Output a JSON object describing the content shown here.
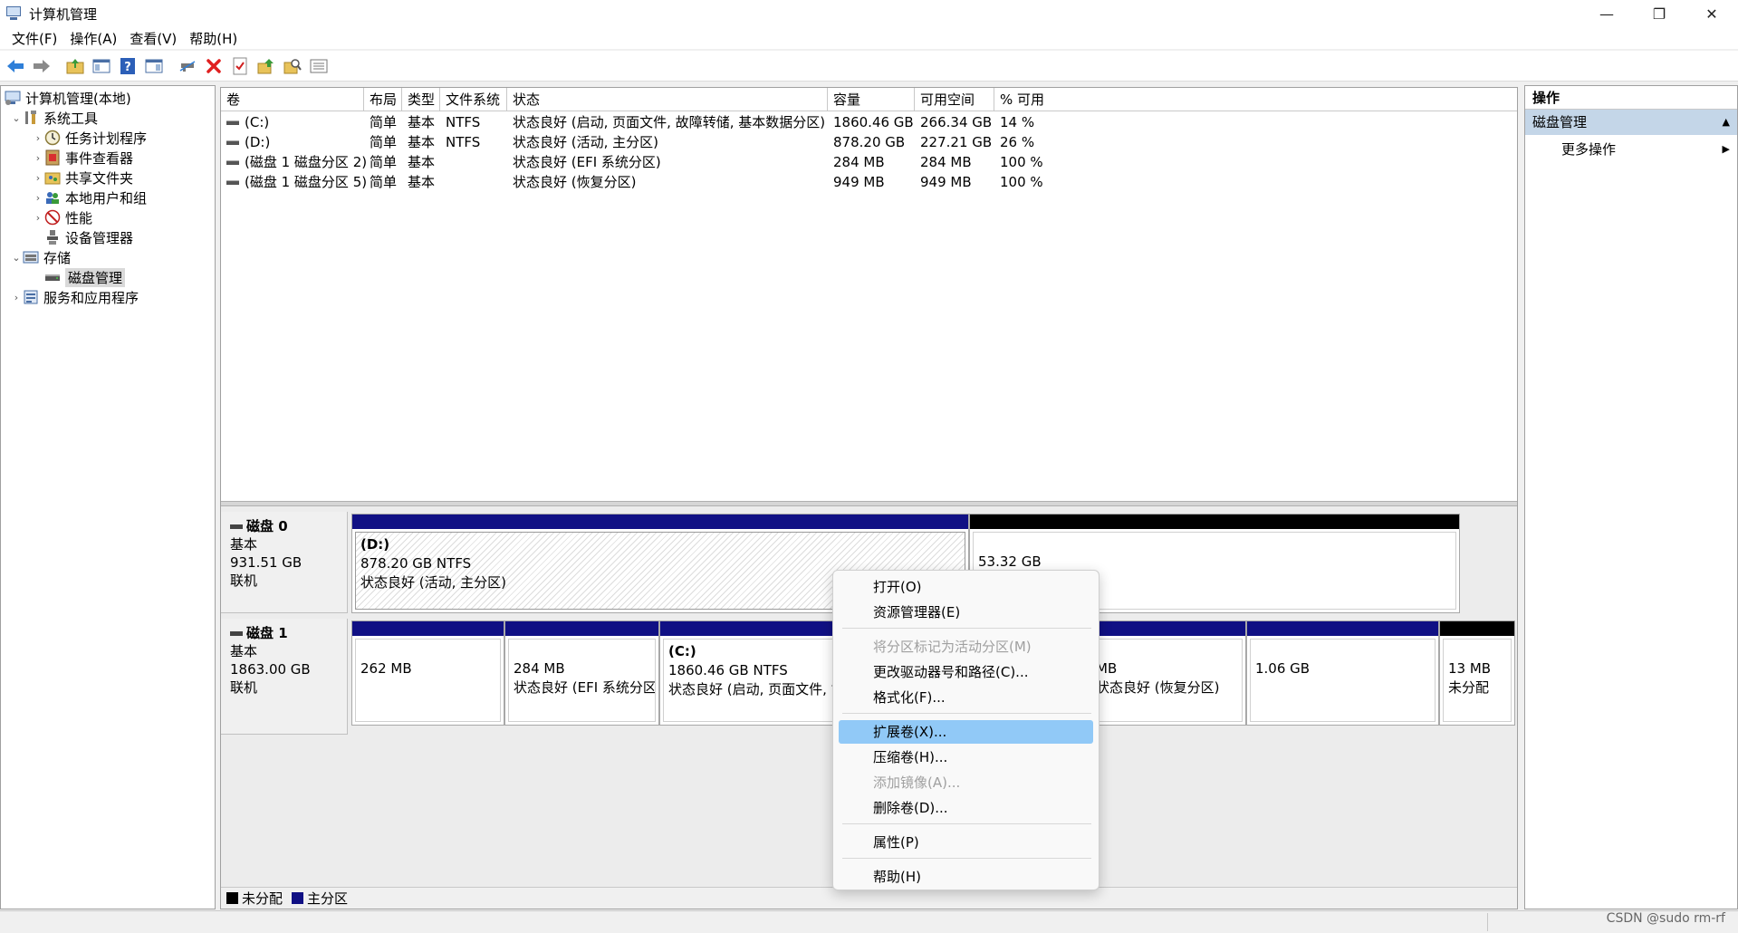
{
  "window": {
    "title": "计算机管理",
    "controls": {
      "minimize": "—",
      "restore": "❐",
      "close": "✕"
    }
  },
  "menubar": [
    {
      "label": "文件(F)"
    },
    {
      "label": "操作(A)"
    },
    {
      "label": "查看(V)"
    },
    {
      "label": "帮助(H)"
    }
  ],
  "toolbar_icons": [
    "back-icon",
    "forward-icon",
    "up-folder-icon",
    "show-hide-tree-icon",
    "help-icon",
    "show-hide-action-icon",
    "connect-icon",
    "delete-icon",
    "properties-icon",
    "export-icon",
    "search-icon",
    "list-view-icon"
  ],
  "tree": {
    "root": "计算机管理(本地)",
    "system_tools": "系统工具",
    "task_scheduler": "任务计划程序",
    "event_viewer": "事件查看器",
    "shared_folders": "共享文件夹",
    "local_users": "本地用户和组",
    "performance": "性能",
    "device_manager": "设备管理器",
    "storage": "存储",
    "disk_management": "磁盘管理",
    "services_apps": "服务和应用程序"
  },
  "volume_table": {
    "columns": [
      "卷",
      "布局",
      "类型",
      "文件系统",
      "状态",
      "容量",
      "可用空间",
      "% 可用"
    ],
    "rows": [
      [
        "(C:)",
        "简单",
        "基本",
        "NTFS",
        "状态良好 (启动, 页面文件, 故障转储, 基本数据分区)",
        "1860.46 GB",
        "266.34 GB",
        "14 %"
      ],
      [
        "(D:)",
        "简单",
        "基本",
        "NTFS",
        "状态良好 (活动, 主分区)",
        "878.20 GB",
        "227.21 GB",
        "26 %"
      ],
      [
        "(磁盘 1 磁盘分区 2)",
        "简单",
        "基本",
        "",
        "状态良好 (EFI 系统分区)",
        "284 MB",
        "284 MB",
        "100 %"
      ],
      [
        "(磁盘 1 磁盘分区 5)",
        "简单",
        "基本",
        "",
        "状态良好 (恢复分区)",
        "949 MB",
        "949 MB",
        "100 %"
      ]
    ]
  },
  "disk0": {
    "name": "磁盘 0",
    "type": "基本",
    "size": "931.51 GB",
    "status": "联机",
    "partitions": {
      "d": {
        "name": "(D:)",
        "size": "878.20 GB NTFS",
        "status": "状态良好 (活动, 主分区)"
      },
      "unalloc": {
        "size": "53.32 GB"
      }
    }
  },
  "disk1": {
    "name": "磁盘 1",
    "type": "基本",
    "size": "1863.00 GB",
    "status": "联机",
    "partitions": {
      "p1": {
        "size": "262 MB"
      },
      "p2": {
        "size": "284 MB",
        "status": "状态良好 (EFI 系统分区"
      },
      "c": {
        "name": "(C:)",
        "size": "1860.46 GB NTFS",
        "status": "状态良好 (启动, 页面文件, 故"
      },
      "recovery": {
        "size": "MB",
        "status": "状态良好 (恢复分区)"
      },
      "p6": {
        "size": "1.06 GB"
      },
      "unalloc": {
        "size": "13 MB",
        "status": "未分配"
      }
    }
  },
  "legend": {
    "unallocated": "未分配",
    "primary": "主分区"
  },
  "actions": {
    "header": "操作",
    "section": "磁盘管理",
    "more": "更多操作"
  },
  "context_menu": {
    "open": "打开(O)",
    "explore": "资源管理器(E)",
    "mark_active": "将分区标记为活动分区(M)",
    "change_letter": "更改驱动器号和路径(C)...",
    "format": "格式化(F)...",
    "extend": "扩展卷(X)...",
    "shrink": "压缩卷(H)...",
    "add_mirror": "添加镜像(A)...",
    "delete": "删除卷(D)...",
    "properties": "属性(P)",
    "help": "帮助(H)"
  },
  "watermark": "CSDN @sudo rm-rf",
  "colors": {
    "primary_partition": "#101084",
    "unallocated": "#000000",
    "menu_highlight": "#91c9f7",
    "action_section": "#c4d6e8"
  }
}
